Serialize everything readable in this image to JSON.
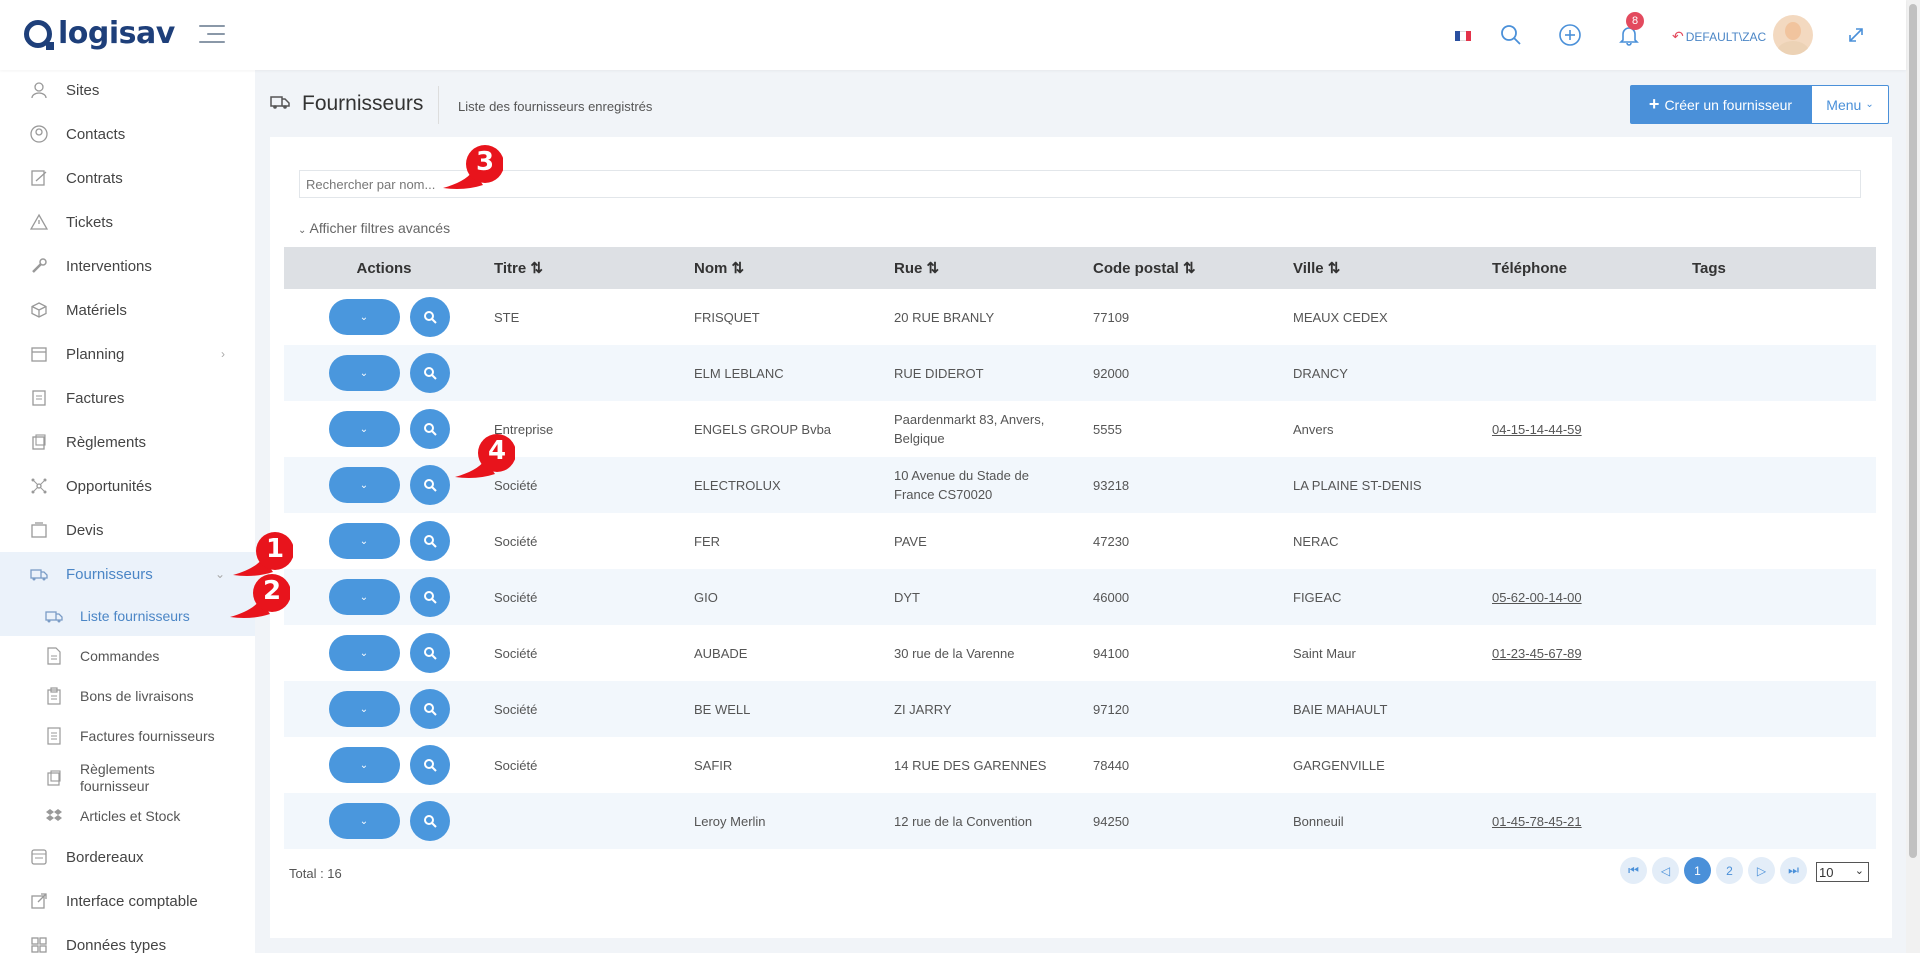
{
  "header": {
    "logo_text": "logisav",
    "notification_count": "8",
    "user_label": "DEFAULT\\ZAC"
  },
  "sidebar": {
    "items": [
      {
        "label": "Sites",
        "icon": "user-pin-icon"
      },
      {
        "label": "Contacts",
        "icon": "contacts-icon"
      },
      {
        "label": "Contrats",
        "icon": "contract-icon"
      },
      {
        "label": "Tickets",
        "icon": "warning-icon"
      },
      {
        "label": "Interventions",
        "icon": "wrench-icon"
      },
      {
        "label": "Matériels",
        "icon": "box-icon"
      },
      {
        "label": "Planning",
        "icon": "calendar-icon"
      },
      {
        "label": "Factures",
        "icon": "invoice-icon"
      },
      {
        "label": "Règlements",
        "icon": "coins-icon"
      },
      {
        "label": "Opportunités",
        "icon": "network-icon"
      },
      {
        "label": "Devis",
        "icon": "folder-icon"
      },
      {
        "label": "Fournisseurs",
        "icon": "truck-icon"
      }
    ],
    "sub_items": [
      {
        "label": "Liste fournisseurs",
        "icon": "truck-icon"
      },
      {
        "label": "Commandes",
        "icon": "document-icon"
      },
      {
        "label": "Bons de livraisons",
        "icon": "clipboard-icon"
      },
      {
        "label": "Factures fournisseurs",
        "icon": "invoice-icon"
      },
      {
        "label": "Règlements fournisseur",
        "icon": "coins-icon"
      },
      {
        "label": "Articles et Stock",
        "icon": "dropbox-icon"
      }
    ],
    "bottom_items": [
      {
        "label": "Bordereaux",
        "icon": "ledger-icon"
      },
      {
        "label": "Interface comptable",
        "icon": "external-link-icon"
      },
      {
        "label": "Données types",
        "icon": "grid-icon"
      }
    ]
  },
  "page": {
    "title": "Fournisseurs",
    "subtitle": "Liste des fournisseurs enregistrés",
    "create_button": "Créer un fournisseur",
    "menu_button": "Menu"
  },
  "search": {
    "placeholder": "Rechercher par nom..."
  },
  "advanced_filters": "Afficher filtres avancés",
  "table": {
    "headers": [
      "Actions",
      "Titre",
      "Nom",
      "Rue",
      "Code postal",
      "Ville",
      "Téléphone",
      "Tags"
    ],
    "rows": [
      {
        "titre": "STE",
        "nom": "FRISQUET",
        "rue": "20 RUE BRANLY",
        "cp": "77109",
        "ville": "MEAUX CEDEX",
        "tel": ""
      },
      {
        "titre": "",
        "nom": "ELM LEBLANC",
        "rue": "RUE DIDEROT",
        "cp": "92000",
        "ville": "DRANCY",
        "tel": ""
      },
      {
        "titre": "Entreprise",
        "nom": "ENGELS GROUP Bvba",
        "rue": "Paardenmarkt 83, Anvers, Belgique",
        "cp": "5555",
        "ville": "Anvers",
        "tel": "04-15-14-44-59"
      },
      {
        "titre": "Société",
        "nom": "ELECTROLUX",
        "rue": "10 Avenue du Stade de France CS70020",
        "cp": "93218",
        "ville": "LA PLAINE ST-DENIS",
        "tel": ""
      },
      {
        "titre": "Société",
        "nom": "FER",
        "rue": "PAVE",
        "cp": "47230",
        "ville": "NERAC",
        "tel": ""
      },
      {
        "titre": "Société",
        "nom": "GIO",
        "rue": "DYT",
        "cp": "46000",
        "ville": "FIGEAC",
        "tel": "05-62-00-14-00"
      },
      {
        "titre": "Société",
        "nom": "AUBADE",
        "rue": "30 rue de la Varenne",
        "cp": "94100",
        "ville": "Saint Maur",
        "tel": "01-23-45-67-89"
      },
      {
        "titre": "Société",
        "nom": "BE WELL",
        "rue": "ZI JARRY",
        "cp": "97120",
        "ville": "BAIE MAHAULT",
        "tel": ""
      },
      {
        "titre": "Société",
        "nom": "SAFIR",
        "rue": "14 RUE DES GARENNES",
        "cp": "78440",
        "ville": "GARGENVILLE",
        "tel": ""
      },
      {
        "titre": "",
        "nom": "Leroy Merlin",
        "rue": "12 rue de la Convention",
        "cp": "94250",
        "ville": "Bonneuil",
        "tel": "01-45-78-45-21"
      }
    ]
  },
  "footer": {
    "total": "Total : 16",
    "pages": [
      "1",
      "2"
    ],
    "current_page": "1",
    "page_size": "10"
  },
  "markers": [
    "1",
    "2",
    "3",
    "4"
  ],
  "colors": {
    "accent": "#4a90d9",
    "marker": "#e8141c",
    "badge": "#e34a5e",
    "logo": "#1e3f7a"
  }
}
